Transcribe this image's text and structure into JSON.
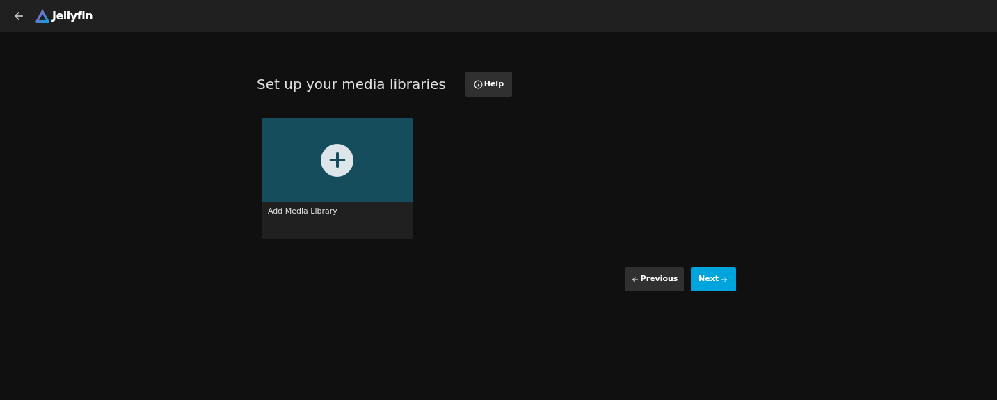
{
  "header": {
    "app_name": "Jellyfin"
  },
  "page": {
    "title": "Set up your media libraries",
    "help_button": "Help"
  },
  "library_cards": [
    {
      "kind": "add",
      "label": "Add Media Library"
    }
  ],
  "buttons": [
    {
      "label": "Previous",
      "kind": "secondary"
    },
    {
      "label": "Next",
      "kind": "primary"
    }
  ]
}
